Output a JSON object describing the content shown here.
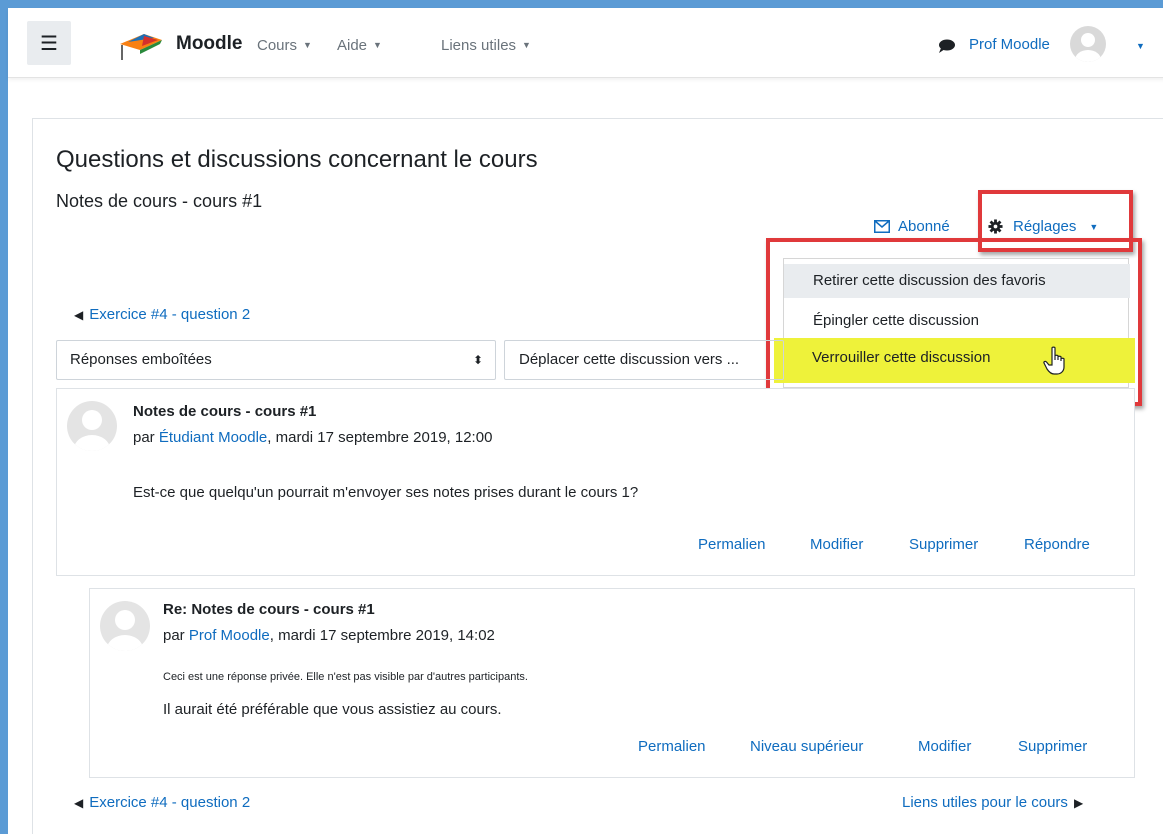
{
  "navbar": {
    "menu_icon": "hamburger-icon",
    "brand": "Moodle",
    "menus": [
      "Cours",
      "Aide",
      "Liens utiles"
    ],
    "user_name": "Prof Moodle"
  },
  "page": {
    "title": "Questions et discussions concernant le cours",
    "subtitle": "Notes de cours - cours #1"
  },
  "actions": {
    "subscribed": "Abonné",
    "settings": "Réglages"
  },
  "settings_menu": {
    "items": [
      "Retirer cette discussion des favoris",
      "Épingler cette discussion",
      "Verrouiller cette discussion"
    ]
  },
  "navigation": {
    "prev": "Exercice #4 - question 2",
    "next": "Liens utiles pour le cours"
  },
  "controls": {
    "display_mode": "Réponses emboîtées",
    "move_discussion": "Déplacer cette discussion vers ..."
  },
  "posts": [
    {
      "title": "Notes de cours - cours #1",
      "by": "par ",
      "author": "Étudiant Moodle",
      "date": ", mardi 17 septembre 2019, 12:00",
      "body": "Est-ce que quelqu'un pourrait m'envoyer ses notes prises durant le cours 1?",
      "actions": [
        "Permalien",
        "Modifier",
        "Supprimer",
        "Répondre"
      ]
    },
    {
      "title": "Re: Notes de cours - cours #1",
      "by": "par ",
      "author": "Prof Moodle",
      "date": ", mardi 17 septembre 2019, 14:02",
      "note": "Ceci est une réponse privée. Elle n'est pas visible par d'autres participants.",
      "body": "Il aurait été préférable que vous assistiez au cours.",
      "actions": [
        "Permalien",
        "Niveau supérieur",
        "Modifier",
        "Supprimer"
      ]
    }
  ],
  "colors": {
    "link": "#0f6cbf",
    "highlight": "#eef23a",
    "annotation_box": "#e0393b",
    "frame": "#5b9bd5"
  }
}
